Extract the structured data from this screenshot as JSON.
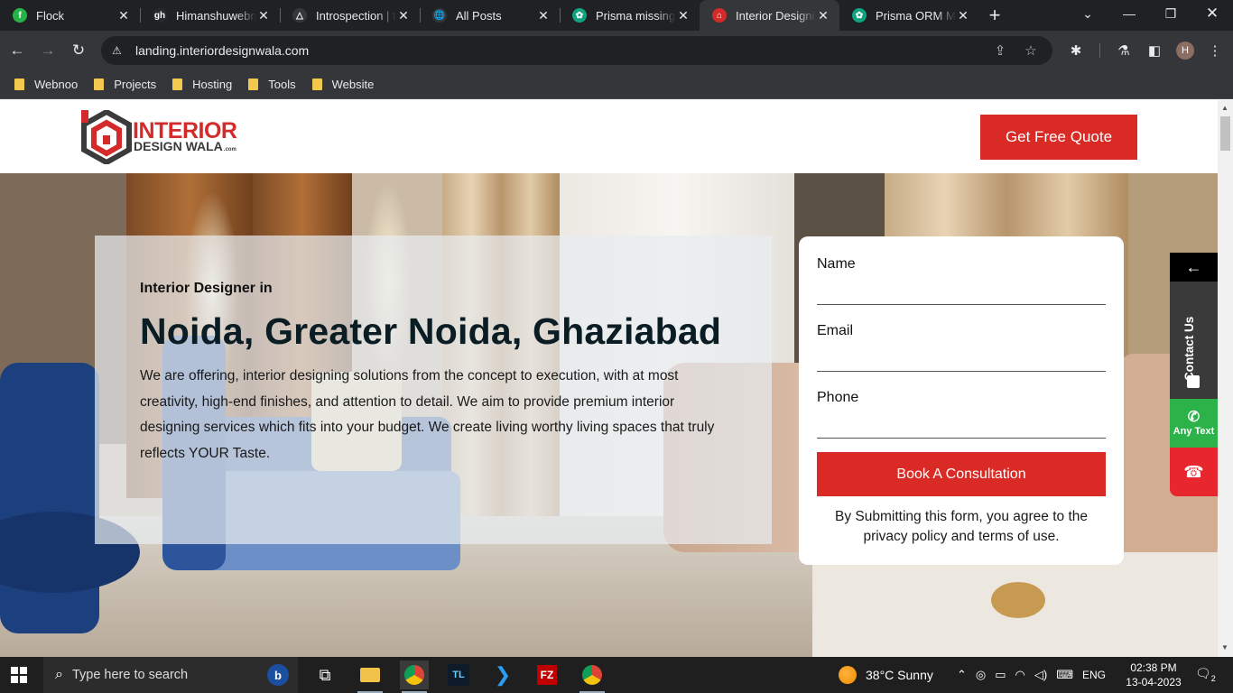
{
  "browser": {
    "tabs": [
      {
        "title": "Flock",
        "favicon_color": "#26b34a",
        "favicon_glyph": "f"
      },
      {
        "title": "Himanshuwebnoo",
        "favicon_color": "#24292e",
        "favicon_glyph": "gh"
      },
      {
        "title": "Introspection | type",
        "favicon_color": "#35363a",
        "favicon_glyph": "△"
      },
      {
        "title": "All Posts",
        "favicon_color": "#35363a",
        "favicon_glyph": "🌐"
      },
      {
        "title": "Prisma missing rela",
        "favicon_color": "#10a37f",
        "favicon_glyph": "✿"
      },
      {
        "title": "Interior Designing",
        "favicon_color": "#d42a2a",
        "favicon_glyph": "⌂"
      },
      {
        "title": "Prisma ORM MySQL",
        "favicon_color": "#10a37f",
        "favicon_glyph": "✿"
      }
    ],
    "url": "landing.interiordesignwala.com",
    "bookmarks": [
      "Webnoo",
      "Projects",
      "Hosting",
      "Tools",
      "Website"
    ],
    "profile_initial": "H"
  },
  "site": {
    "logo": {
      "line1": "INTERIOR",
      "line2": "DESIGN WALA",
      "suffix": ".com"
    },
    "cta": "Get Free Quote",
    "hero": {
      "eyebrow": "Interior Designer in",
      "heading": "Noida, Greater Noida, Ghaziabad",
      "description": "We are offering, interior designing solutions from the concept to execution, with at most creativity, high-end finishes, and attention to detail. We aim to provide premium interior designing services which fits into your budget. We create living worthy living spaces that truly reflects YOUR Taste."
    },
    "form": {
      "name_label": "Name",
      "email_label": "Email",
      "phone_label": "Phone",
      "submit": "Book A Consultation",
      "disclaimer": "By Submitting this form, you agree to the privacy policy and terms of use."
    },
    "side_widget": {
      "contact_label": "Contact Us",
      "whatsapp_label": "Any Text"
    }
  },
  "taskbar": {
    "search_placeholder": "Type here to search",
    "weather": "38°C  Sunny",
    "language": "ENG",
    "time": "02:38 PM",
    "date": "13-04-2023",
    "notifications": "2"
  },
  "colors": {
    "brand_red": "#d92a25",
    "whatsapp_green": "#2bb34a",
    "call_red": "#e8262e",
    "heading_dark": "#0b1d24"
  }
}
